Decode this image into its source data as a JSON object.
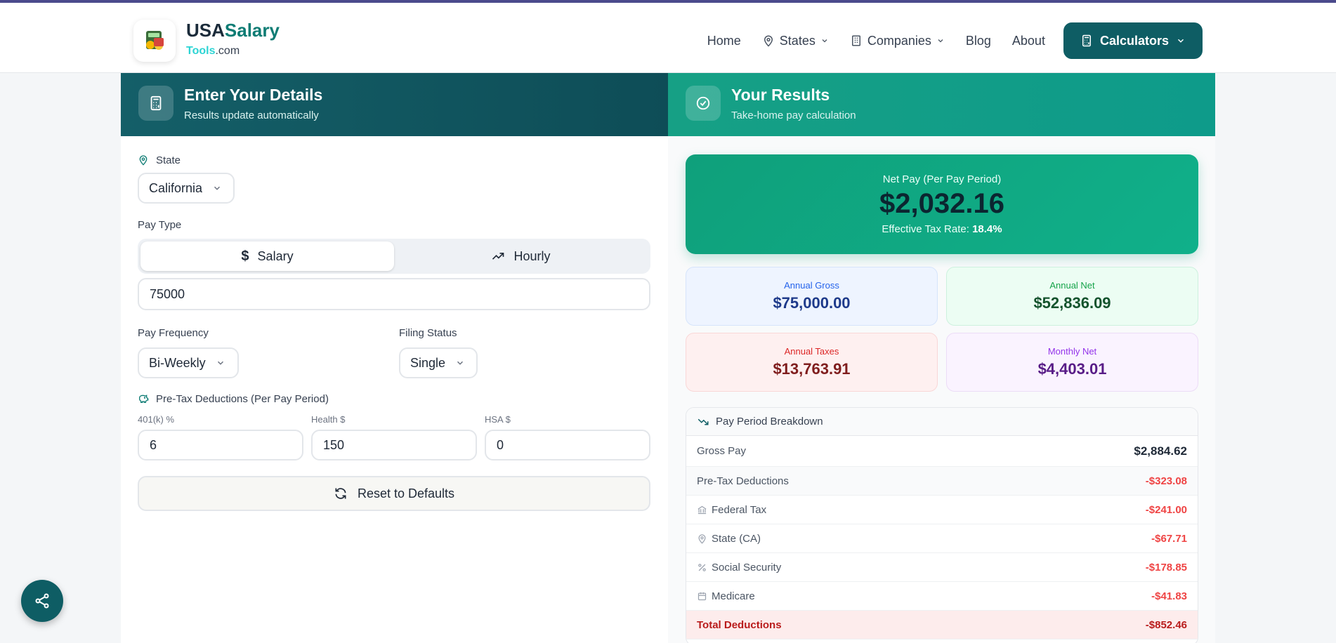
{
  "brand": {
    "name_a": "USA",
    "name_b": "Salary",
    "sub_a": "Tools",
    "sub_b": ".com"
  },
  "nav": {
    "home": "Home",
    "states": "States",
    "companies": "Companies",
    "blog": "Blog",
    "about": "About",
    "calculators": "Calculators"
  },
  "form": {
    "title": "Enter Your Details",
    "subtitle": "Results update automatically",
    "state_label": "State",
    "state_value": "California",
    "pay_type_label": "Pay Type",
    "pay_type_options": [
      "Salary",
      "Hourly"
    ],
    "pay_type_selected": "Salary",
    "salary_value": "75000",
    "pay_frequency_label": "Pay Frequency",
    "pay_frequency_value": "Bi-Weekly",
    "filing_status_label": "Filing Status",
    "filing_status_value": "Single",
    "pretax_label": "Pre-Tax Deductions (Per Pay Period)",
    "k401_label": "401(k) %",
    "k401_value": "6",
    "health_label": "Health $",
    "health_value": "150",
    "hsa_label": "HSA $",
    "hsa_value": "0",
    "reset_label": "Reset to Defaults"
  },
  "results": {
    "title": "Your Results",
    "subtitle": "Take-home pay calculation",
    "net_label": "Net Pay (Per Pay Period)",
    "net_value": "$2,032.16",
    "rate_label": "Effective Tax Rate:",
    "rate_value": "18.4%",
    "annual_gross_label": "Annual Gross",
    "annual_gross_value": "$75,000.00",
    "annual_net_label": "Annual Net",
    "annual_net_value": "$52,836.09",
    "annual_taxes_label": "Annual Taxes",
    "annual_taxes_value": "$13,763.91",
    "monthly_net_label": "Monthly Net",
    "monthly_net_value": "$4,403.01"
  },
  "breakdown": {
    "title": "Pay Period Breakdown",
    "rows": [
      {
        "label": "Gross Pay",
        "value": "$2,884.62",
        "icon": ""
      },
      {
        "label": "Pre-Tax Deductions",
        "value": "-$323.08",
        "icon": ""
      },
      {
        "label": "Federal Tax",
        "value": "-$241.00",
        "icon": "bank-icon"
      },
      {
        "label": "State (CA)",
        "value": "-$67.71",
        "icon": "map-pin-icon"
      },
      {
        "label": "Social Security",
        "value": "-$178.85",
        "icon": "percent-icon"
      },
      {
        "label": "Medicare",
        "value": "-$41.83",
        "icon": "calendar-icon"
      },
      {
        "label": "Total Deductions",
        "value": "-$852.46",
        "icon": ""
      }
    ]
  },
  "colors": {
    "teal_dark": "#0e5d64",
    "green": "#10b08a",
    "red": "#ef4444"
  }
}
